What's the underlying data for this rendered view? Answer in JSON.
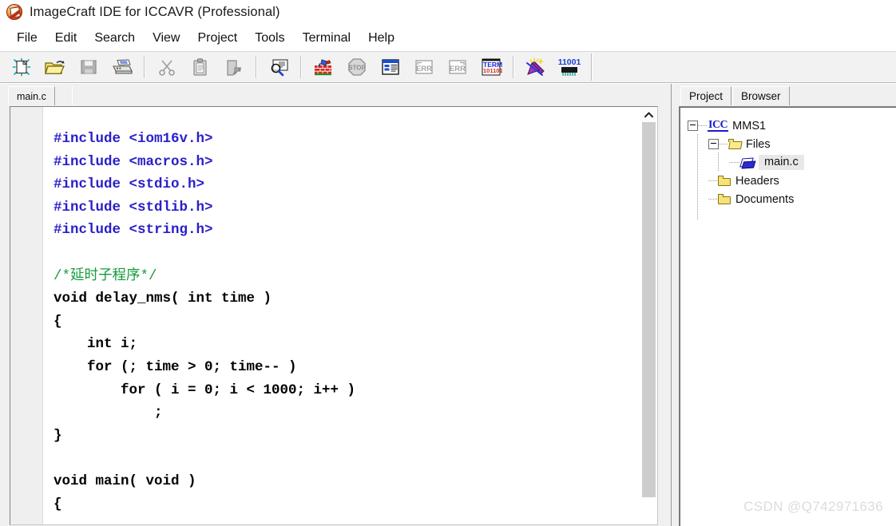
{
  "window": {
    "title": "ImageCraft IDE for ICCAVR (Professional)",
    "logo_icon": "imagecraft-logo-icon"
  },
  "menubar": {
    "items": [
      {
        "label": "File"
      },
      {
        "label": "Edit"
      },
      {
        "label": "Search"
      },
      {
        "label": "View"
      },
      {
        "label": "Project"
      },
      {
        "label": "Tools"
      },
      {
        "label": "Terminal"
      },
      {
        "label": "Help"
      }
    ]
  },
  "toolbar": {
    "buttons": [
      {
        "name": "new-file-button",
        "icon": "new-file-icon",
        "enabled": true,
        "tooltip": "New"
      },
      {
        "name": "open-file-button",
        "icon": "open-folder-icon",
        "enabled": true,
        "tooltip": "Open"
      },
      {
        "name": "save-file-button",
        "icon": "save-disk-icon",
        "enabled": false,
        "tooltip": "Save"
      },
      {
        "name": "print-button",
        "icon": "printer-icon",
        "enabled": true,
        "tooltip": "Print"
      },
      {
        "name": "cut-button",
        "icon": "scissors-icon",
        "enabled": false,
        "tooltip": "Cut"
      },
      {
        "name": "copy-button",
        "icon": "clipboard-icon",
        "enabled": false,
        "tooltip": "Copy"
      },
      {
        "name": "paste-button",
        "icon": "paste-icon",
        "enabled": false,
        "tooltip": "Paste"
      },
      {
        "name": "find-button",
        "icon": "find-magnifier-icon",
        "enabled": true,
        "tooltip": "Find"
      },
      {
        "name": "build-button",
        "icon": "build-hammer-icon",
        "enabled": true,
        "tooltip": "Make Project"
      },
      {
        "name": "stop-build-button",
        "icon": "stop-sign-icon",
        "enabled": false,
        "tooltip": "Stop Build"
      },
      {
        "name": "project-settings-button",
        "icon": "project-window-icon",
        "enabled": true,
        "tooltip": "Project Settings"
      },
      {
        "name": "prev-error-button",
        "icon": "error-prev-icon",
        "enabled": false,
        "tooltip": "Previous Error"
      },
      {
        "name": "next-error-button",
        "icon": "error-next-icon",
        "enabled": false,
        "tooltip": "Next Error"
      },
      {
        "name": "terminal-button",
        "icon": "terminal-icon",
        "enabled": true,
        "tooltip": "Terminal"
      },
      {
        "name": "app-builder-button",
        "icon": "wizard-wand-icon",
        "enabled": true,
        "tooltip": "Application Builder"
      },
      {
        "name": "program-chip-button",
        "icon": "chip-11001-icon",
        "enabled": true,
        "tooltip": "Program Chip",
        "label": "11001"
      }
    ]
  },
  "editor": {
    "tabs": [
      {
        "label": "main.c",
        "active": true
      }
    ],
    "scrollbar": {
      "up_arrow_icon": "chevron-up-icon",
      "thumb_position_percent": 0
    },
    "code_lines": [
      {
        "text": "#include <iom16v.h>",
        "type": "preprocessor"
      },
      {
        "text": "#include <macros.h>",
        "type": "preprocessor"
      },
      {
        "text": "#include <stdio.h>",
        "type": "preprocessor"
      },
      {
        "text": "#include <stdlib.h>",
        "type": "preprocessor"
      },
      {
        "text": "#include <string.h>",
        "type": "preprocessor"
      },
      {
        "text": "",
        "type": "blank"
      },
      {
        "text": "/*延时子程序*/",
        "type": "comment"
      },
      {
        "text": "void delay_nms( int time )",
        "type": "code"
      },
      {
        "text": "{",
        "type": "code"
      },
      {
        "text": "    int i;",
        "type": "code"
      },
      {
        "text": "    for (; time > 0; time-- )",
        "type": "code"
      },
      {
        "text": "        for ( i = 0; i < 1000; i++ )",
        "type": "code"
      },
      {
        "text": "            ;",
        "type": "code"
      },
      {
        "text": "}",
        "type": "code"
      },
      {
        "text": "",
        "type": "blank"
      },
      {
        "text": "void main( void )",
        "type": "code"
      },
      {
        "text": "{",
        "type": "code"
      }
    ]
  },
  "project_panel": {
    "tabs": [
      {
        "label": "Project",
        "active": true
      },
      {
        "label": "Browser",
        "active": false
      }
    ],
    "tree": {
      "root": {
        "label": "MMS1",
        "icon": "icc-project-icon",
        "expanded": true,
        "children": [
          {
            "label": "Files",
            "icon": "folder-open-icon",
            "expanded": true,
            "children": [
              {
                "label": "main.c",
                "icon": "c-source-file-icon",
                "selected": true
              }
            ]
          },
          {
            "label": "Headers",
            "icon": "folder-closed-icon",
            "expanded": false
          },
          {
            "label": "Documents",
            "icon": "folder-closed-icon",
            "expanded": false
          }
        ]
      }
    }
  },
  "watermark": {
    "text": "CSDN @Q742971636"
  },
  "colors": {
    "preprocessor": "#2a20c8",
    "comment": "#159b3c",
    "keyword": "#000000",
    "toolbar_bg": "#f2f2f2",
    "pane_bg": "#f0f0f0",
    "editor_bg": "#ffffff",
    "selection_bg": "#e8e8e8",
    "watermark": "#dcdcdc"
  }
}
